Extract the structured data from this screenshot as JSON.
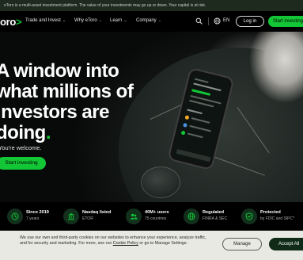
{
  "topbar": {
    "disclaimer": "eToro is a multi-asset investment platform. The value of your investments may go up or down. Your capital is at risk."
  },
  "nav": {
    "logo_text": "oro",
    "logo_chevron": ">",
    "items": [
      {
        "label": "Trade and Invest"
      },
      {
        "label": "Why eToro"
      },
      {
        "label": "Learn"
      },
      {
        "label": "Company"
      }
    ],
    "language": "EN",
    "login_label": "Log in",
    "cta_label": "Start investing"
  },
  "hero": {
    "headline_lines": [
      "A window into",
      "what millions of",
      "investors are",
      "doing"
    ],
    "headline_dot": ".",
    "subtext": "You're welcome.",
    "cta_label": "Start investing"
  },
  "stats": [
    {
      "title": "Since 2019",
      "subtitle": "7 years",
      "icon": "clock-icon"
    },
    {
      "title": "Nasdaq listed",
      "subtitle": "ETOR",
      "icon": "bank-icon"
    },
    {
      "title": "40M+ users",
      "subtitle": "75 countries",
      "icon": "users-icon"
    },
    {
      "title": "Regulated",
      "subtitle": "FINRA & SEC",
      "icon": "globe-icon"
    },
    {
      "title": "Protected",
      "subtitle": "by FDIC and SIPC*",
      "icon": "shield-icon"
    }
  ],
  "cookie": {
    "text_before": "We use our own and third-party cookies on our websites to enhance your experience, analyze traffic, and for security and marketing. For more, see our ",
    "link_label": "Cookie Policy",
    "text_after": " or go to Manage Settings.",
    "manage_label": "Manage",
    "accept_label": "Accept All"
  },
  "colors": {
    "accent": "#13c636",
    "background": "#000000",
    "cookie_bg": "#e9e9e3",
    "accept_bg": "#0f2a17"
  }
}
